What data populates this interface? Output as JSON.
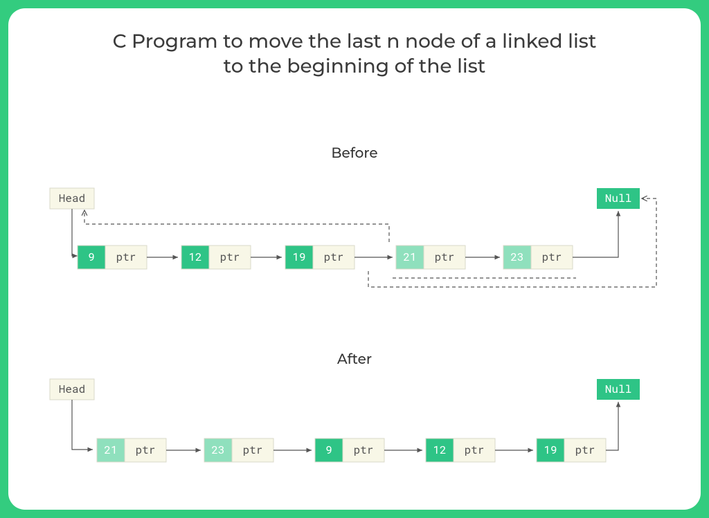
{
  "title_line1": "C Program to move the last n node of a linked list",
  "title_line2": "to the beginning of the list",
  "labels": {
    "before": "Before",
    "after": "After",
    "head": "Head",
    "null": "Null",
    "ptr": "ptr"
  },
  "before": {
    "nodes": [
      {
        "val": "9",
        "shade": "dark"
      },
      {
        "val": "12",
        "shade": "dark"
      },
      {
        "val": "19",
        "shade": "dark"
      },
      {
        "val": "21",
        "shade": "light"
      },
      {
        "val": "23",
        "shade": "light"
      }
    ]
  },
  "after": {
    "nodes": [
      {
        "val": "21",
        "shade": "light"
      },
      {
        "val": "23",
        "shade": "light"
      },
      {
        "val": "9",
        "shade": "dark"
      },
      {
        "val": "12",
        "shade": "dark"
      },
      {
        "val": "19",
        "shade": "dark"
      }
    ]
  }
}
